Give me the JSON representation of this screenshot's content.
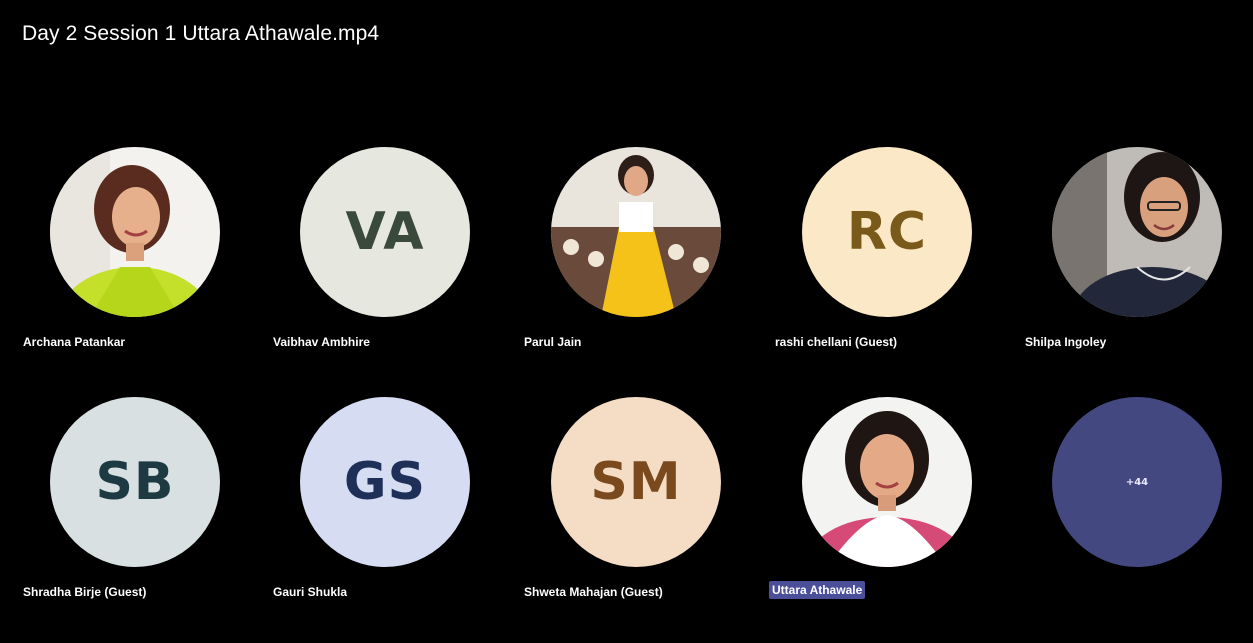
{
  "video": {
    "title": "Day 2 Session 1 Uttara Athawale.mp4"
  },
  "participants": [
    {
      "name": "Archana Patankar",
      "type": "photo",
      "photo_icon": "person-photo-green-saree"
    },
    {
      "name": "Vaibhav Ambhire",
      "type": "initials",
      "initials": "VA",
      "bg": "#e6e8e0",
      "fg": "#3a4a3a"
    },
    {
      "name": "Parul Jain",
      "type": "photo",
      "photo_icon": "person-photo-yellow-saree"
    },
    {
      "name": "rashi chellani (Guest)",
      "type": "initials",
      "initials": "RC",
      "bg": "#fbe8c6",
      "fg": "#7a5a1a"
    },
    {
      "name": "Shilpa Ingoley",
      "type": "photo",
      "photo_icon": "person-photo-dark-top"
    },
    {
      "name": "Shradha Birje (Guest)",
      "type": "initials",
      "initials": "SB",
      "bg": "#d8e0e2",
      "fg": "#1d3a42"
    },
    {
      "name": "Gauri Shukla",
      "type": "initials",
      "initials": "GS",
      "bg": "#d6dcf2",
      "fg": "#1f3058"
    },
    {
      "name": "Shweta Mahajan (Guest)",
      "type": "initials",
      "initials": "SM",
      "bg": "#f5dcc4",
      "fg": "#7a4a1e"
    },
    {
      "name": "Uttara Athawale",
      "type": "photo",
      "photo_icon": "person-photo-white-dupatta",
      "highlight": true
    },
    {
      "name": "",
      "type": "overflow",
      "count_label": "+44",
      "bg": "#434880"
    }
  ]
}
